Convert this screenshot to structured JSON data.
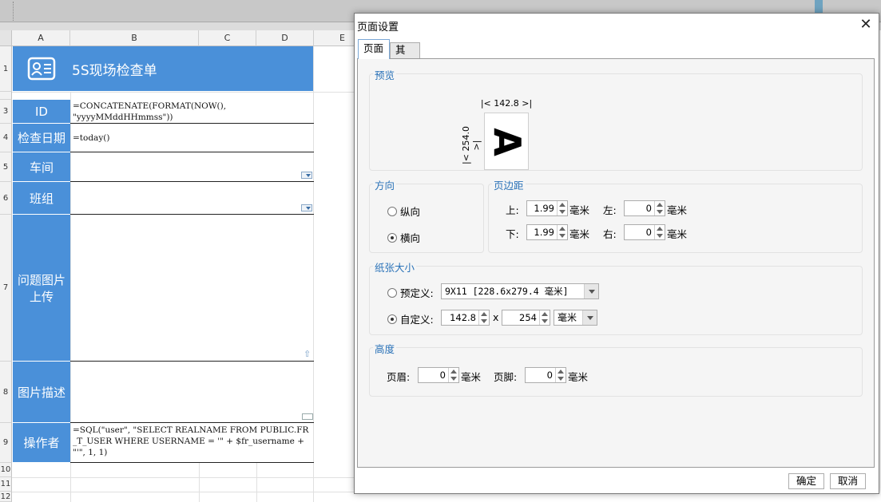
{
  "columns": [
    "A",
    "B",
    "C",
    "D",
    "E"
  ],
  "rows": [
    "1",
    "3",
    "4",
    "5",
    "6",
    "7",
    "8",
    "9",
    "10",
    "11",
    "12"
  ],
  "sheet": {
    "title": "5S现场检查单",
    "labels": {
      "id": "ID",
      "date": "检查日期",
      "workshop": "车间",
      "team": "班组",
      "photo": "问题图片上传",
      "desc": "图片描述",
      "operator": "操作者"
    },
    "formulas": {
      "id": "=CONCATENATE(FORMAT(NOW(), \"yyyyMMddHHmmss\"))",
      "date": "=today()",
      "operator": "=SQL(\"user\", \"SELECT REALNAME FROM PUBLIC.FR_T_USER WHERE USERNAME = '\" + $fr_username + \"'\", 1, 1)"
    },
    "colors": {
      "label_bg": "#4a90d9",
      "label_text": "#ffffff"
    }
  },
  "dialog": {
    "title": "页面设置",
    "tabs": [
      {
        "label": "页面",
        "active": true
      },
      {
        "label": "其他",
        "active": false
      }
    ],
    "preview": {
      "title": "预览",
      "width_label": "142.8",
      "height_label": "254.0",
      "glyph": "A"
    },
    "orientation": {
      "title": "方向",
      "portrait_label": "纵向",
      "landscape_label": "横向",
      "selected": "landscape"
    },
    "margins": {
      "title": "页边距",
      "top_label": "上:",
      "top_value": "1.99",
      "bottom_label": "下:",
      "bottom_value": "1.99",
      "left_label": "左:",
      "left_value": "0",
      "right_label": "右:",
      "right_value": "0",
      "unit": "毫米"
    },
    "paper": {
      "title": "纸张大小",
      "predefined_label": "预定义:",
      "predefined_value": "9X11 [228.6x279.4 毫米]",
      "custom_label": "自定义:",
      "custom_width": "142.8",
      "times": "x",
      "custom_height": "254",
      "unit": "毫米",
      "selected": "custom"
    },
    "height": {
      "title": "高度",
      "header_label": "页眉:",
      "header_value": "0",
      "footer_label": "页脚:",
      "footer_value": "0",
      "unit": "毫米"
    },
    "ok_label": "确定",
    "cancel_label": "取消"
  }
}
